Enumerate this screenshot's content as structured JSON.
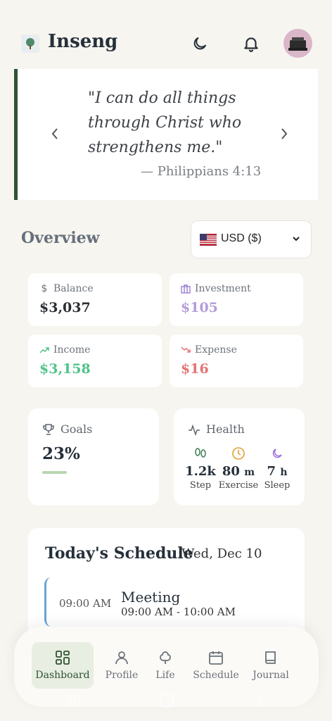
{
  "header": {
    "app_title": "Inseng",
    "icons": [
      "logo-icon",
      "moon-icon",
      "bell-icon",
      "avatar"
    ]
  },
  "verse": {
    "line1": "\"I can do all things",
    "line2": "through Christ who",
    "line3": "strengthens me.\"",
    "reference": "— Philippians 4:13",
    "accent": "#2f5233"
  },
  "overview": {
    "title": "Overview",
    "currency": "USD ($)"
  },
  "stats": {
    "balance": {
      "label": "Balance",
      "value": "$3,037",
      "color": "#2b2f33"
    },
    "investment": {
      "label": "Investment",
      "value": "$105",
      "color": "#b39ddb"
    },
    "income": {
      "label": "Income",
      "value": "$3,158",
      "color": "#4fc38a"
    },
    "expense": {
      "label": "Expense",
      "value": "$16",
      "color": "#e57373"
    }
  },
  "goals": {
    "label": "Goals",
    "value": "23%",
    "progress": 0.23
  },
  "health": {
    "label": "Health",
    "step": {
      "value": "1.2k",
      "label": "Step"
    },
    "exercise": {
      "value": "80",
      "unit": "m",
      "label": "Exercise"
    },
    "sleep": {
      "value": "7",
      "unit": "h",
      "label": "Sleep"
    }
  },
  "schedule": {
    "title": "Today's Schedule",
    "date": "Wed, Dec 10",
    "events": [
      {
        "time": "09:00 AM",
        "title": "Meeting",
        "range": "09:00 AM - 10:00 AM"
      }
    ]
  },
  "nav": {
    "items": [
      {
        "label": "Dashboard",
        "icon": "grid-icon",
        "active": true
      },
      {
        "label": "Profile",
        "icon": "user-icon"
      },
      {
        "label": "Life",
        "icon": "tree-icon"
      },
      {
        "label": "Schedule",
        "icon": "calendar-icon"
      },
      {
        "label": "Journal",
        "icon": "book-icon"
      }
    ]
  }
}
